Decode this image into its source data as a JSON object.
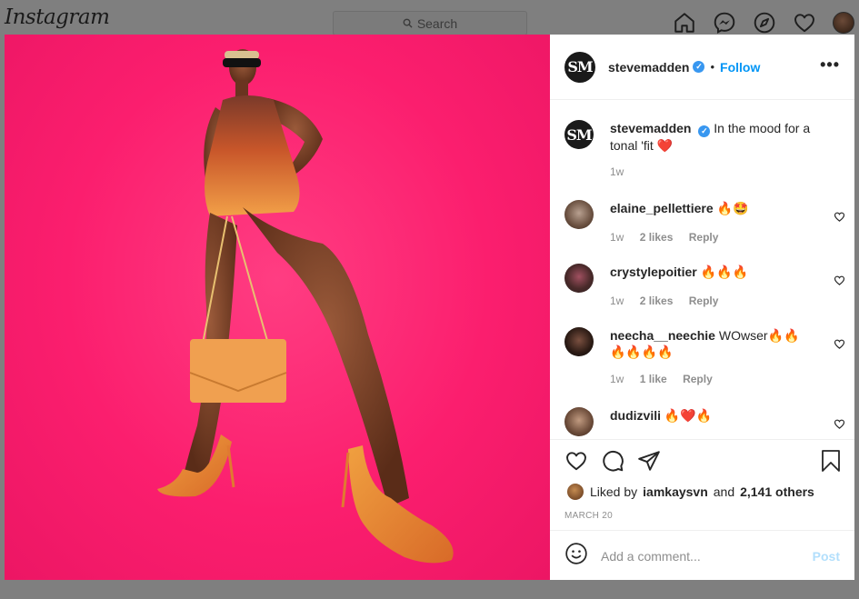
{
  "topnav": {
    "logo": "Instagram",
    "search_placeholder": "Search",
    "icons": [
      "home-icon",
      "messenger-icon",
      "explore-icon",
      "activity-heart-icon",
      "profile-avatar"
    ]
  },
  "post": {
    "account": "stevemadden",
    "avatar_text": "SM",
    "verified": true,
    "follow_label": "Follow",
    "separator": "•",
    "more_label": "•••",
    "caption": {
      "username": "stevemadden",
      "text": "In the mood for a tonal 'fit ❤️",
      "time": "1w"
    },
    "comments": [
      {
        "username": "elaine_pellettiere",
        "text": "🔥🤩",
        "time": "1w",
        "likes": "2 likes",
        "reply": "Reply"
      },
      {
        "username": "crystylepoitier",
        "text": "🔥🔥🔥",
        "time": "1w",
        "likes": "2 likes",
        "reply": "Reply"
      },
      {
        "username": "neecha__neechie",
        "text": "WOwser🔥🔥🔥🔥🔥🔥",
        "time": "1w",
        "likes": "1 like",
        "reply": "Reply"
      },
      {
        "username": "dudizvili",
        "text": "🔥❤️🔥",
        "time": "",
        "likes": "",
        "reply": ""
      }
    ],
    "liked_by_prefix": "Liked by",
    "liked_by_user": "iamkaysvn",
    "liked_by_and": "and",
    "liked_by_others": "2,141 others",
    "date": "MARCH 20",
    "comment_placeholder": "Add a comment...",
    "post_label": "Post"
  },
  "colors": {
    "photo_background": "#fb1e6e",
    "accent": "#0095f6",
    "post_disabled": "#b2dffc"
  }
}
